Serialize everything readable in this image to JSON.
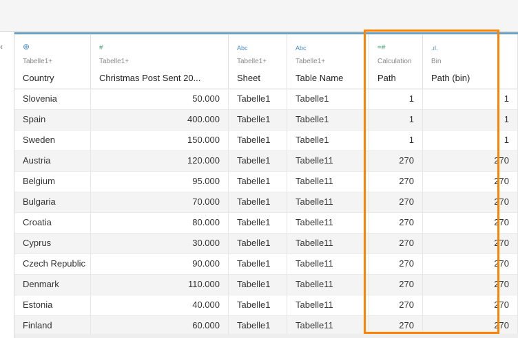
{
  "collapse_arrow": "‹",
  "colors": {
    "accent_blue": "#6a9fc6",
    "highlight": "#ff8200",
    "type_green": "#3fa27a",
    "type_blue": "#4a8bbf"
  },
  "columns": [
    {
      "key": "country",
      "type_icon": "globe-icon",
      "type_glyph": "⊕",
      "source": "Tabelle1+",
      "name": "Country",
      "align": "l"
    },
    {
      "key": "christmas",
      "type_icon": "number-icon",
      "type_glyph": "#",
      "source": "Tabelle1+",
      "name": "Christmas Post Sent 20...",
      "align": "r"
    },
    {
      "key": "sheet",
      "type_icon": "string-icon",
      "type_glyph": "Abc",
      "source": "Tabelle1+",
      "name": "Sheet",
      "align": "l"
    },
    {
      "key": "table_name",
      "type_icon": "string-icon",
      "type_glyph": "Abc",
      "source": "Tabelle1+",
      "name": "Table Name",
      "align": "l"
    },
    {
      "key": "path",
      "type_icon": "calculated-number-icon",
      "type_glyph": "=#",
      "source": "Calculation",
      "name": "Path",
      "align": "r"
    },
    {
      "key": "path_bin",
      "type_icon": "bin-icon",
      "type_glyph": ".ıl.",
      "source": "Bin",
      "name": "Path (bin)",
      "align": "r"
    }
  ],
  "rows": [
    [
      "Slovenia",
      "50.000",
      "Tabelle1",
      "Tabelle1",
      "1",
      "1"
    ],
    [
      "Spain",
      "400.000",
      "Tabelle1",
      "Tabelle1",
      "1",
      "1"
    ],
    [
      "Sweden",
      "150.000",
      "Tabelle1",
      "Tabelle1",
      "1",
      "1"
    ],
    [
      "Austria",
      "120.000",
      "Tabelle1",
      "Tabelle11",
      "270",
      "270"
    ],
    [
      "Belgium",
      "95.000",
      "Tabelle1",
      "Tabelle11",
      "270",
      "270"
    ],
    [
      "Bulgaria",
      "70.000",
      "Tabelle1",
      "Tabelle11",
      "270",
      "270"
    ],
    [
      "Croatia",
      "80.000",
      "Tabelle1",
      "Tabelle11",
      "270",
      "270"
    ],
    [
      "Cyprus",
      "30.000",
      "Tabelle1",
      "Tabelle11",
      "270",
      "270"
    ],
    [
      "Czech Republic",
      "90.000",
      "Tabelle1",
      "Tabelle11",
      "270",
      "270"
    ],
    [
      "Denmark",
      "110.000",
      "Tabelle1",
      "Tabelle11",
      "270",
      "270"
    ],
    [
      "Estonia",
      "40.000",
      "Tabelle1",
      "Tabelle11",
      "270",
      "270"
    ],
    [
      "Finland",
      "60.000",
      "Tabelle1",
      "Tabelle11",
      "270",
      "270"
    ]
  ]
}
